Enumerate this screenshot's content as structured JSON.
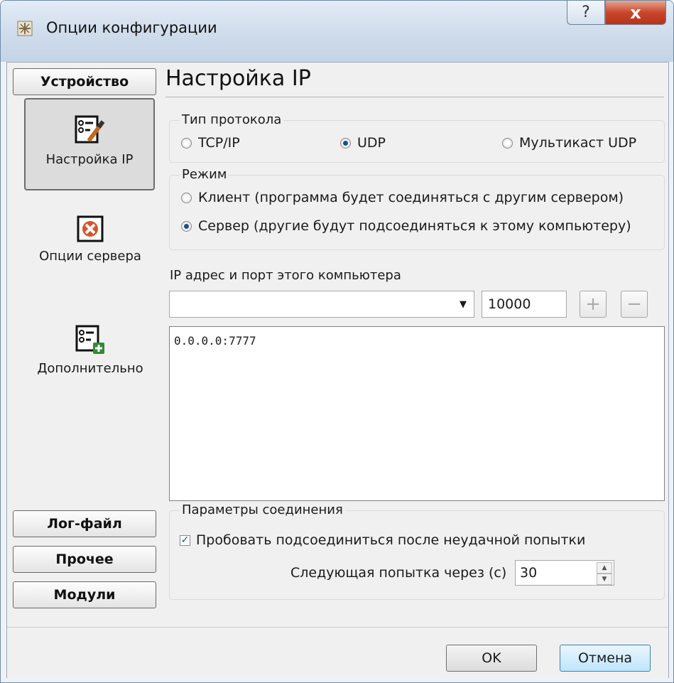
{
  "window": {
    "title": "Опции конфигурации",
    "help_label": "?",
    "close_label": "x"
  },
  "sidebar": {
    "device_button": "Устройство",
    "items": [
      {
        "label": "Настройка IP",
        "icon": "list-edit-icon",
        "active": true
      },
      {
        "label": "Опции сервера",
        "icon": "server-x-icon",
        "active": false
      },
      {
        "label": "Дополнительно",
        "icon": "list-add-icon",
        "active": false
      }
    ],
    "bottom_buttons": [
      "Лог-файл",
      "Прочее",
      "Модули"
    ]
  },
  "main": {
    "title": "Настройка IP",
    "protocol": {
      "label": "Тип протокола",
      "options": [
        "TCP/IP",
        "UDP",
        "Мультикаст UDP"
      ],
      "selected": "UDP"
    },
    "mode": {
      "label": "Режим",
      "options": [
        "Клиент (программа будет соединяться с другим сервером)",
        "Сервер (другие будут подсоединяться к этому компьютеру)"
      ],
      "selected": "Сервер (другие будут подсоединяться к этому компьютеру)"
    },
    "ip_section": {
      "label": "IP адрес и порт этого компьютера",
      "address_value": "",
      "port_value": "10000",
      "add_label": "+",
      "remove_label": "−"
    },
    "address_list": [
      "0.0.0.0:7777"
    ],
    "connection": {
      "label": "Параметры соединения",
      "retry_label": "Пробовать подсоединиться после неудачной попытки",
      "retry_checked": true,
      "next_attempt_label": "Следующая попытка через (с)",
      "next_attempt_value": "30"
    }
  },
  "footer": {
    "ok_label": "OK",
    "cancel_label": "Отмена"
  }
}
